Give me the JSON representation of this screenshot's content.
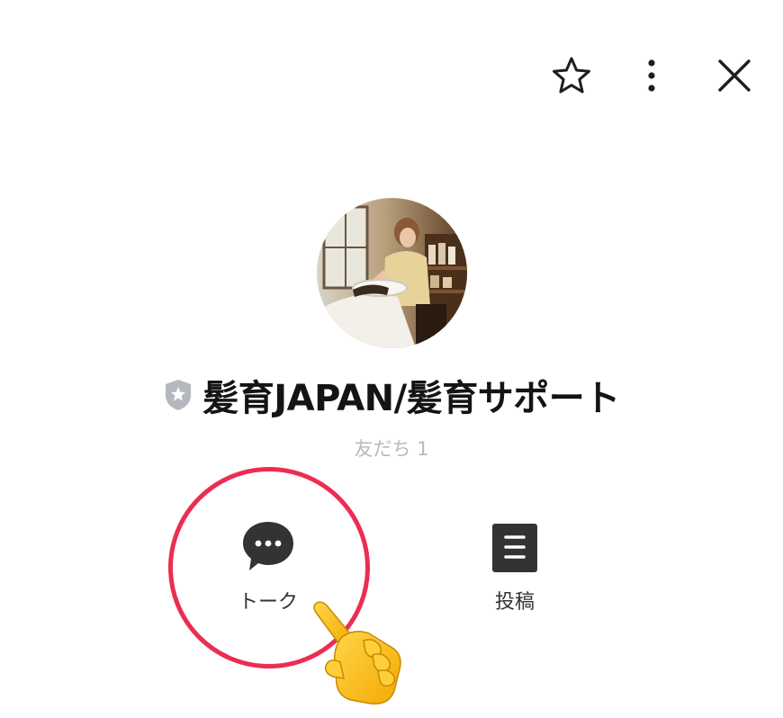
{
  "header": {
    "icons": [
      "star-icon",
      "more-vertical-icon",
      "close-icon"
    ]
  },
  "profile": {
    "name": "髪育JAPAN/髪育サポート",
    "friends_label": "友だち 1",
    "badge_icon": "shield-star-icon",
    "avatar_description_icon": "profile-photo"
  },
  "actions": {
    "talk_label": "トーク",
    "post_label": "投稿"
  },
  "colors": {
    "highlight_ring": "#ec2d52",
    "icon_dark": "#333333",
    "badge_gray": "#b5b8be",
    "muted_text": "#b9b9b9"
  },
  "annotations": {
    "pointer": "pointing-hand-emoji"
  }
}
